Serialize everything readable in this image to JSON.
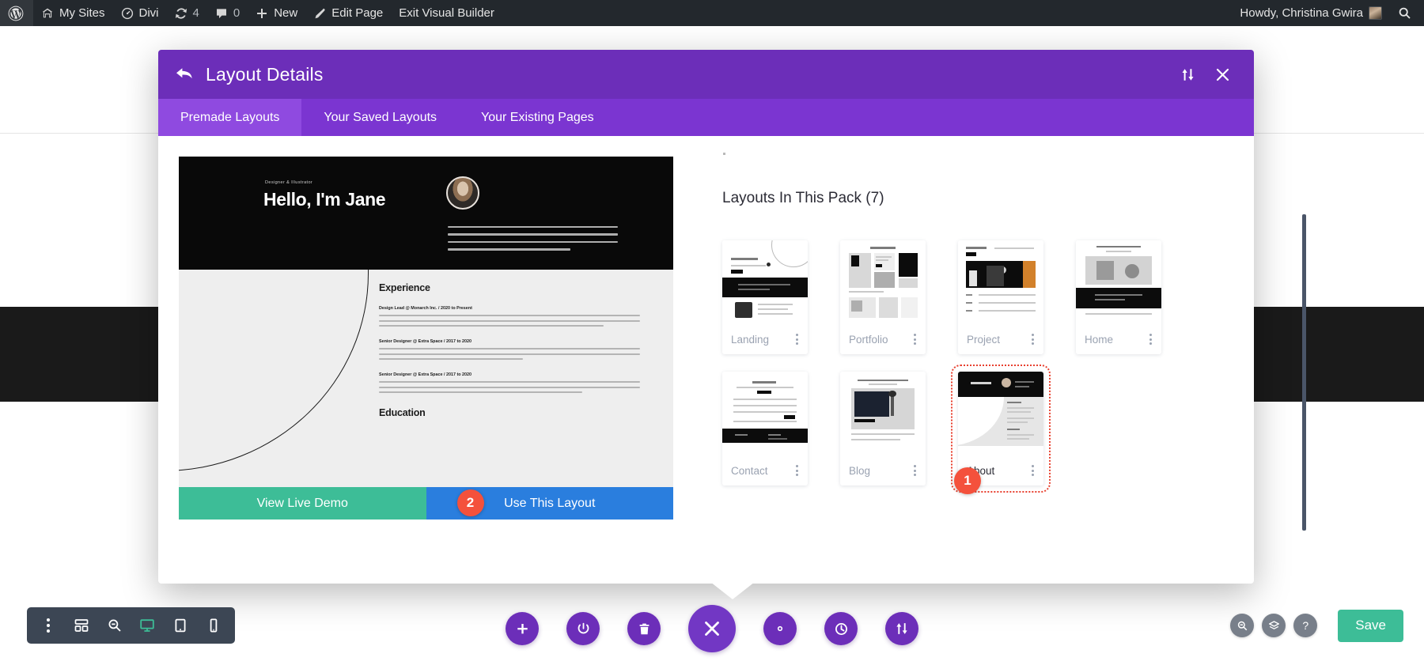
{
  "adminbar": {
    "logo_icon": "wordpress-logo-icon",
    "items": [
      {
        "label": "My Sites",
        "icon": "sites-icon"
      },
      {
        "label": "Divi",
        "icon": "divi-icon"
      },
      {
        "label": "4",
        "icon": "updates-icon"
      },
      {
        "label": "0",
        "icon": "comments-icon"
      },
      {
        "label": "New",
        "icon": "plus-icon"
      },
      {
        "label": "Edit Page",
        "icon": "pencil-icon"
      },
      {
        "label": "Exit Visual Builder",
        "icon": ""
      }
    ],
    "howdy": "Howdy, Christina Gwira",
    "search_icon": "search-icon"
  },
  "modal": {
    "title": "Layout Details",
    "back_icon": "back-arrow-icon",
    "sort_icon": "sort-updown-icon",
    "close_icon": "close-icon",
    "tabs": [
      {
        "label": "Premade Layouts",
        "active": true
      },
      {
        "label": "Your Saved Layouts",
        "active": false
      },
      {
        "label": "Your Existing Pages",
        "active": false
      }
    ],
    "preview": {
      "eyebrow": "Designer & Illustrator",
      "headline": "Hello, I'm Jane",
      "section_experience": "Experience",
      "section_education": "Education",
      "jobs": [
        "Design Lead @ Monarch Inc. / 2020 to Present",
        "Senior Designer @ Extra Space / 2017 to 2020",
        "Senior Designer @ Extra Space / 2017 to 2020"
      ]
    },
    "actions": {
      "view_demo": "View Live Demo",
      "use_layout": "Use This Layout",
      "use_layout_step": "2"
    },
    "pack": {
      "heading": "Layouts In This Pack (7)",
      "selected_step": "1",
      "cards": [
        {
          "label": "Landing",
          "selected": false,
          "art": "landing"
        },
        {
          "label": "Portfolio",
          "selected": false,
          "art": "portfolio"
        },
        {
          "label": "Project",
          "selected": false,
          "art": "project"
        },
        {
          "label": "Home",
          "selected": false,
          "art": "home"
        },
        {
          "label": "Contact",
          "selected": false,
          "art": "contact"
        },
        {
          "label": "Blog",
          "selected": false,
          "art": "blog"
        },
        {
          "label": "About",
          "selected": true,
          "art": "about"
        }
      ]
    }
  },
  "toolbars": {
    "left": [
      {
        "icon": "kebab-menu-icon",
        "active": false
      },
      {
        "icon": "wireframe-icon",
        "active": false
      },
      {
        "icon": "zoom-out-icon",
        "active": false
      },
      {
        "icon": "desktop-icon",
        "active": true
      },
      {
        "icon": "tablet-icon",
        "active": false
      },
      {
        "icon": "phone-icon",
        "active": false
      }
    ],
    "center": [
      {
        "icon": "plus-icon",
        "big": false
      },
      {
        "icon": "power-icon",
        "big": false
      },
      {
        "icon": "trash-icon",
        "big": false
      },
      {
        "icon": "close-icon",
        "big": true
      },
      {
        "icon": "gear-icon",
        "big": false
      },
      {
        "icon": "history-clock-icon",
        "big": false
      },
      {
        "icon": "sort-updown-icon",
        "big": false
      }
    ],
    "right": [
      {
        "icon": "zoom-out-icon"
      },
      {
        "icon": "layers-icon"
      },
      {
        "icon": "help-icon"
      }
    ],
    "save_label": "Save"
  },
  "colors": {
    "adminbar": "#23282d",
    "modal_header": "#6c2eb9",
    "tabs_bar": "#7b35d1",
    "tab_active": "#8f4ae0",
    "demo_button": "#3dbd97",
    "use_button": "#2a7ede",
    "badge": "#f4513c",
    "selected_outline": "#e8402f",
    "toolbar_dark": "#3c4654",
    "save_green": "#3dbd97"
  }
}
